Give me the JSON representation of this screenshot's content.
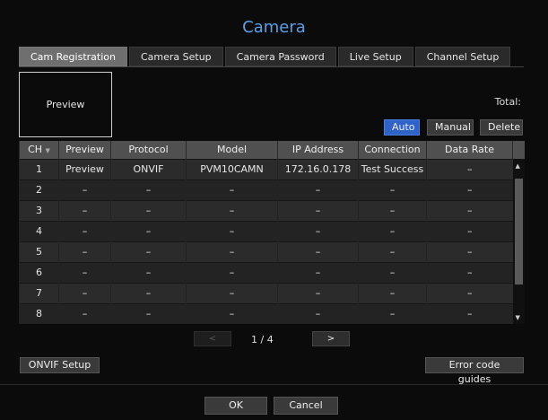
{
  "title": "Camera",
  "tabs": [
    "Cam Registration",
    "Camera Setup",
    "Camera Password",
    "Live Setup",
    "Channel Setup"
  ],
  "preview_box": "Preview",
  "total_label": "Total:",
  "buttons": {
    "auto": "Auto",
    "manual": "Manual",
    "delete": "Delete"
  },
  "table": {
    "headers": [
      "CH",
      "Preview",
      "Protocol",
      "Model",
      "IP Address",
      "Connection",
      "Data Rate"
    ],
    "rows": [
      [
        "1",
        "Preview",
        "ONVIF",
        "PVM10CAMN",
        "172.16.0.178",
        "Test Success",
        "–"
      ],
      [
        "2",
        "–",
        "–",
        "–",
        "–",
        "–",
        "–"
      ],
      [
        "3",
        "–",
        "–",
        "–",
        "–",
        "–",
        "–"
      ],
      [
        "4",
        "–",
        "–",
        "–",
        "–",
        "–",
        "–"
      ],
      [
        "5",
        "–",
        "–",
        "–",
        "–",
        "–",
        "–"
      ],
      [
        "6",
        "–",
        "–",
        "–",
        "–",
        "–",
        "–"
      ],
      [
        "7",
        "–",
        "–",
        "–",
        "–",
        "–",
        "–"
      ],
      [
        "8",
        "–",
        "–",
        "–",
        "–",
        "–",
        "–"
      ]
    ]
  },
  "pager": {
    "prev": "<",
    "text": "1 / 4",
    "next": ">"
  },
  "onvif_setup": "ONVIF Setup",
  "error_guides": "Error code guides",
  "ok": "OK",
  "cancel": "Cancel",
  "icons": {
    "sort": "sort-down-icon",
    "scroll_up": "scroll-up-icon",
    "scroll_down": "scroll-down-icon"
  }
}
